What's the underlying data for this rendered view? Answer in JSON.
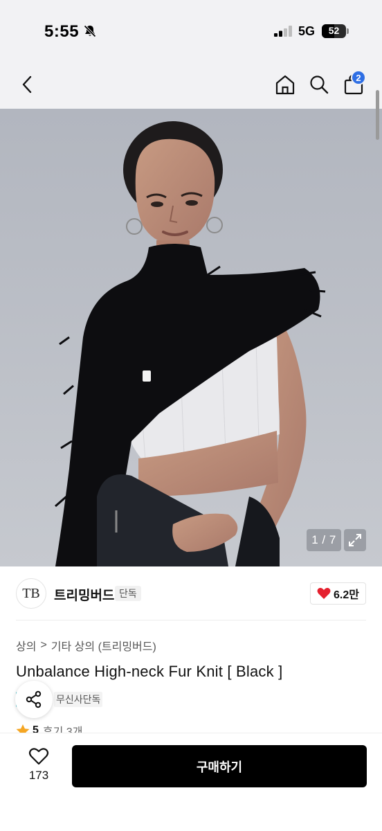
{
  "status_bar": {
    "time": "5:55",
    "network": "5G",
    "battery": "52",
    "battery_level": 0.52
  },
  "nav": {
    "cart_count": "2"
  },
  "hero": {
    "counter": "1 / 7"
  },
  "brand": {
    "logo_text": "TB",
    "name": "트리밍버드",
    "exclusive_tag": "단독",
    "likes": "6.2만"
  },
  "breadcrumb": {
    "level1": "상의",
    "separator": ">",
    "level2": "기타 상의 (트리밍버드)"
  },
  "product": {
    "title": "Unbalance High-neck Fur Knit [ Black ]",
    "badge": "무신사단독",
    "rating": "5",
    "reviews": "후기 3개"
  },
  "bottom": {
    "wish_count": "173",
    "buy_label": "구매하기"
  },
  "colors": {
    "accent_blue": "#2f6fe4",
    "heart_red": "#e5202e",
    "star_orange": "#f5a623",
    "buy_button": "#000000"
  }
}
